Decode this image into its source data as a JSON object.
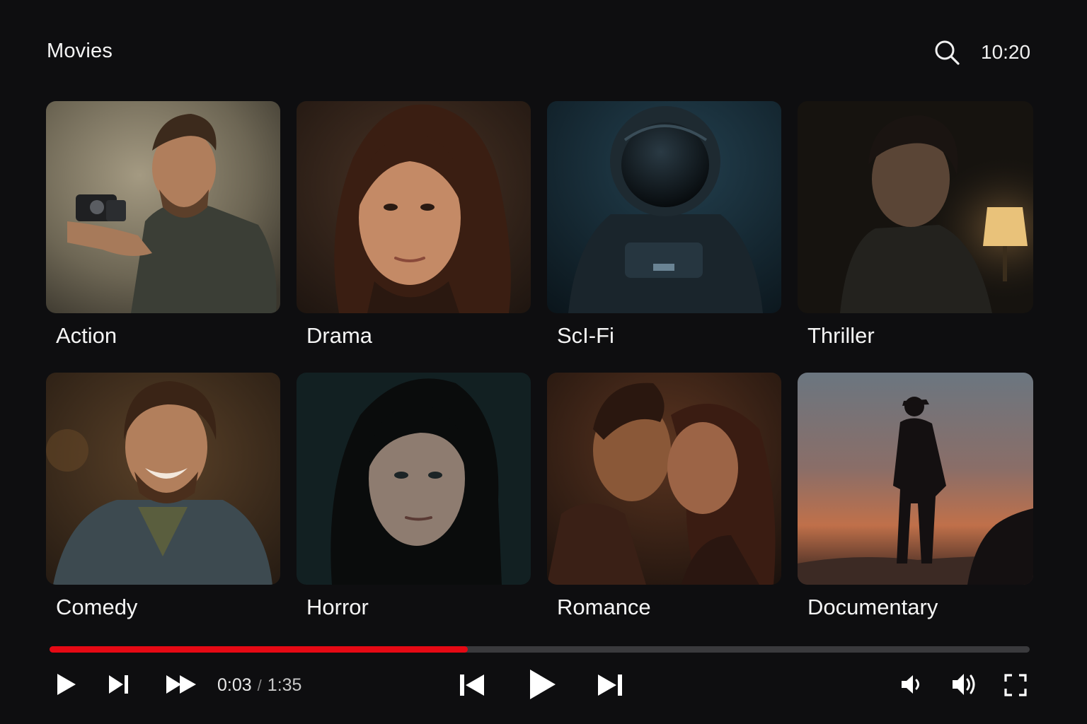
{
  "header": {
    "title": "Movies",
    "clock": "10:20",
    "search_icon": "search-icon"
  },
  "genres": [
    {
      "label": "Action",
      "art": "action"
    },
    {
      "label": "Drama",
      "art": "drama"
    },
    {
      "label": "ScI-Fi",
      "art": "scifi"
    },
    {
      "label": "Thriller",
      "art": "thriller"
    },
    {
      "label": "Comedy",
      "art": "comedy"
    },
    {
      "label": "Horror",
      "art": "horror"
    },
    {
      "label": "Romance",
      "art": "romance"
    },
    {
      "label": "Documentary",
      "art": "documentary"
    }
  ],
  "player": {
    "current_time": "0:03",
    "separator": "/",
    "duration": "1:35",
    "progress_fraction": 0.427,
    "accent_color": "#e50914",
    "controls_left": [
      "play-icon",
      "next-track-icon",
      "fast-forward-icon"
    ],
    "controls_center": [
      "previous-icon",
      "play-icon",
      "next-icon"
    ],
    "controls_right": [
      "volume-down-icon",
      "volume-up-icon",
      "fullscreen-icon"
    ]
  }
}
